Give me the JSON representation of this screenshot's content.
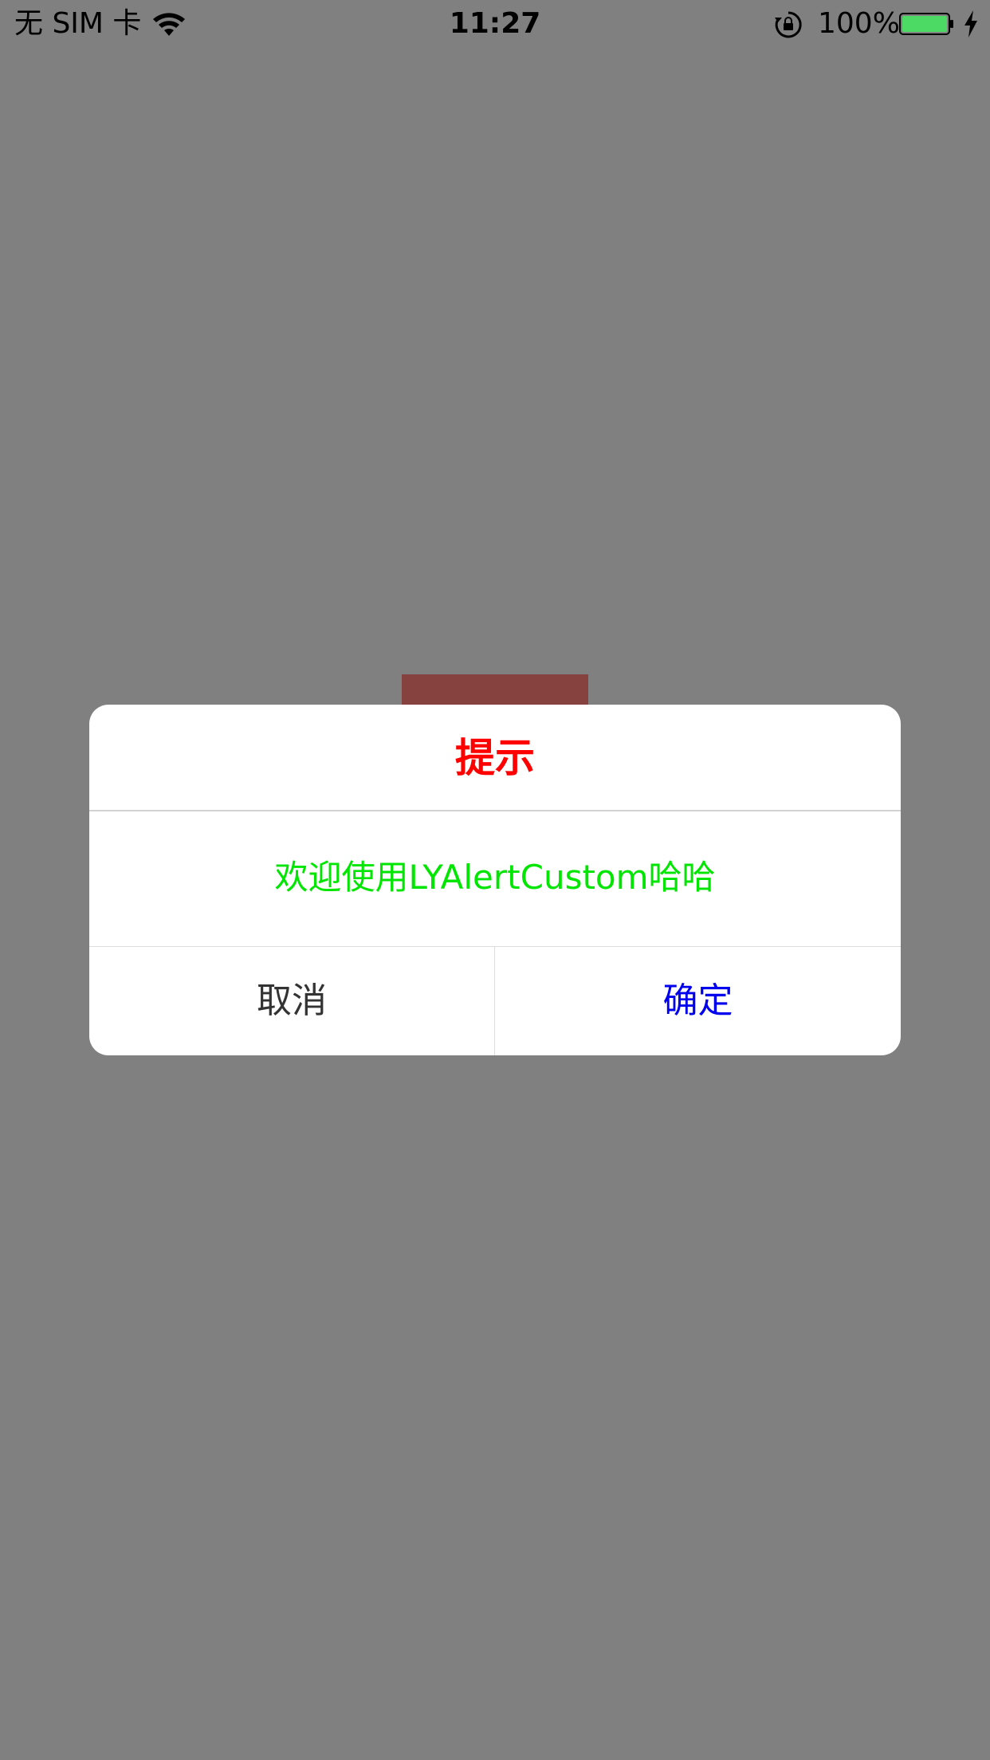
{
  "status_bar": {
    "carrier": "无 SIM 卡",
    "time": "11:27",
    "battery_percent": "100%",
    "battery_level": 1.0,
    "battery_color": "#4cd964",
    "icons": [
      "wifi-icon",
      "rotation-lock-icon",
      "battery-icon",
      "charging-bolt-icon"
    ]
  },
  "alert": {
    "title": "提示",
    "title_color": "#ff0000",
    "message": "欢迎使用LYAlertCustom哈哈",
    "message_color": "#00e600",
    "cancel_label": "取消",
    "confirm_label": "确定",
    "confirm_color": "#0000ee"
  },
  "colors": {
    "overlay": "#808080",
    "background_block": "#86423f"
  }
}
